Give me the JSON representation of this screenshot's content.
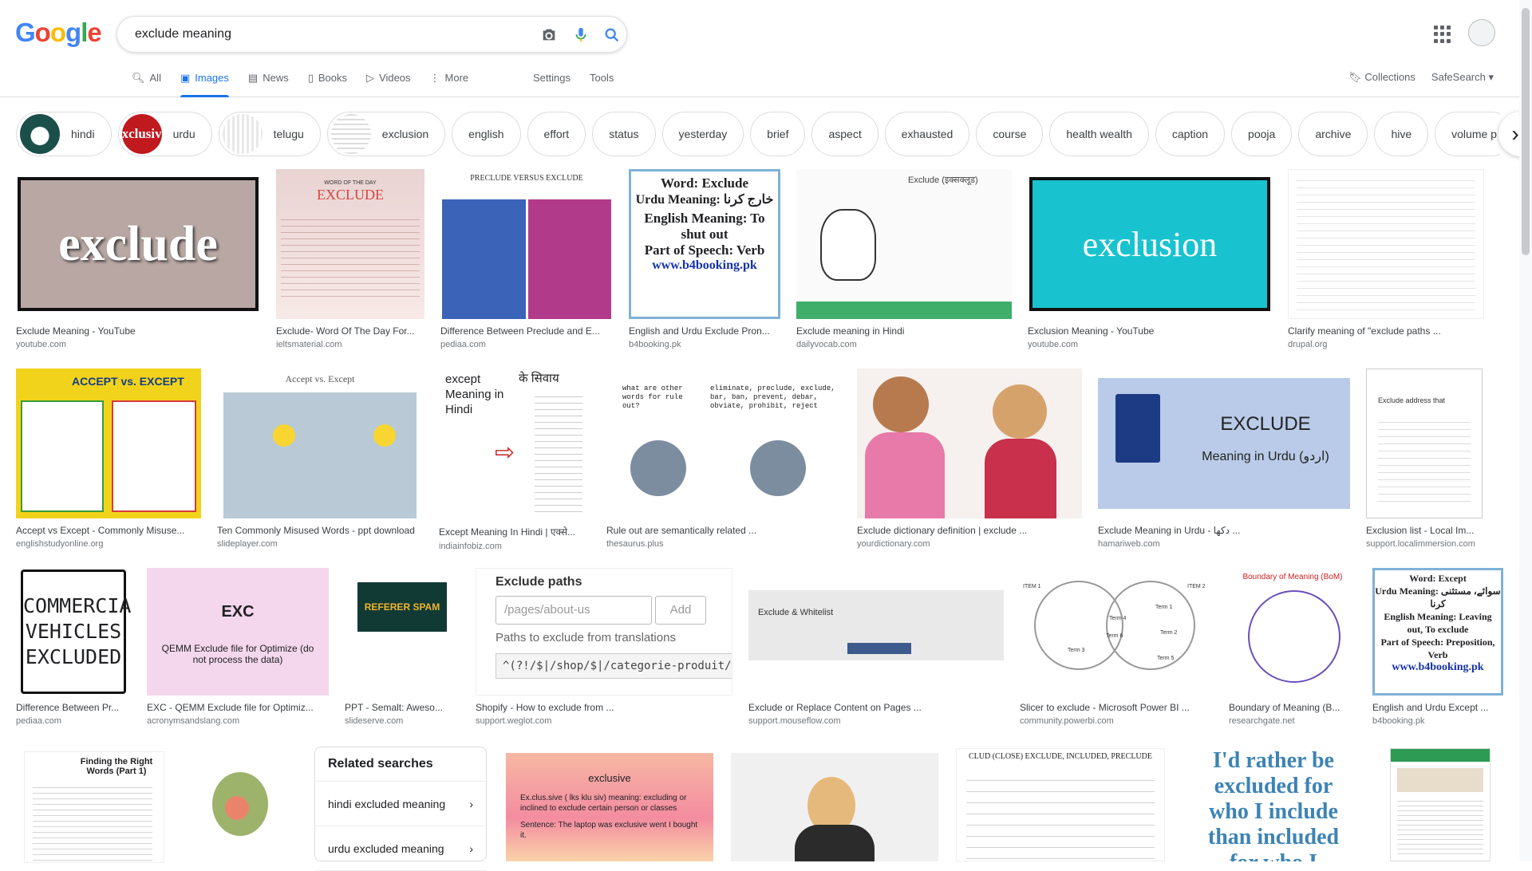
{
  "logo": "Google",
  "search": {
    "query": "exclude meaning"
  },
  "tabs": [
    {
      "label": "All",
      "icon": "search-icon"
    },
    {
      "label": "Images",
      "icon": "image-icon"
    },
    {
      "label": "News",
      "icon": "newspaper-icon"
    },
    {
      "label": "Books",
      "icon": "book-icon"
    },
    {
      "label": "Videos",
      "icon": "play-icon"
    },
    {
      "label": "More",
      "icon": "more-vert-icon"
    }
  ],
  "tools": {
    "settings": "Settings",
    "tools": "Tools"
  },
  "right_links": {
    "collections": "Collections",
    "safesearch": "SafeSearch"
  },
  "chips": [
    "hindi",
    "urdu",
    "telugu",
    "exclusion",
    "english",
    "effort",
    "status",
    "yesterday",
    "brief",
    "aspect",
    "exhausted",
    "course",
    "health wealth",
    "caption",
    "pooja",
    "archive",
    "hive",
    "volume p"
  ],
  "chip_thumb_texts": {
    "urdu": "xclusiv"
  },
  "row1": [
    {
      "title": "Exclude Meaning - YouTube",
      "source": "youtube.com",
      "img_text": "exclude"
    },
    {
      "title": "Exclude- Word Of The Day For...",
      "source": "ieltsmaterial.com",
      "img_text": "EXCLUDE",
      "img_subtitle": "WORD OF THE DAY"
    },
    {
      "title": "Difference Between Preclude and E...",
      "source": "pediaa.com",
      "img_text": "PRECLUDE VERSUS EXCLUDE"
    },
    {
      "title": "English and Urdu Exclude Pron...",
      "source": "b4booking.pk",
      "img_lines": [
        "Word: Exclude",
        "Urdu Meaning: خارج کرنا",
        "English Meaning: To shut out",
        "Part of Speech: Verb",
        "www.b4booking.pk"
      ]
    },
    {
      "title": "Exclude meaning in Hindi",
      "source": "dailyvocab.com",
      "img_text": "Exclude (इक्सक्लूड)"
    },
    {
      "title": "Exclusion Meaning - YouTube",
      "source": "youtube.com",
      "img_text": "exclusion"
    },
    {
      "title": "Clarify meaning of \"exclude paths ...",
      "source": "drupal.org"
    }
  ],
  "row2": [
    {
      "title": "Accept vs Except - Commonly Misuse...",
      "source": "englishstudyonline.org",
      "img_text": "ACCEPT vs. EXCEPT"
    },
    {
      "title": "Ten Commonly Misused Words - ppt download",
      "source": "slideplayer.com",
      "img_text": "Accept vs. Except"
    },
    {
      "title": "Except Meaning In Hindi | एक्से...",
      "source": "indiainfobiz.com",
      "img_text": "except Meaning in Hindi",
      "img_hindi": "के सिवाय"
    },
    {
      "title": "Rule out are semantically related ...",
      "source": "thesaurus.plus",
      "img_text": "what are other words for rule out?",
      "img_words": "eliminate, preclude, exclude, bar, ban, prevent, debar, obviate, prohibit, reject"
    },
    {
      "title": "Exclude dictionary definition | exclude ...",
      "source": "yourdictionary.com"
    },
    {
      "title": "Exclude Meaning in Urdu - دکھا ...",
      "source": "hamariweb.com",
      "img_text": "EXCLUDE",
      "img_sub": "Meaning in Urdu (اردو)"
    },
    {
      "title": "Exclusion list - Local Im...",
      "source": "support.localimmersion.com",
      "img_text": "Exclude address that"
    }
  ],
  "row3": [
    {
      "title": "Difference Between Pr...",
      "source": "pediaa.com",
      "img_lines": [
        "COMMERCIAL",
        "VEHICLES",
        "EXCLUDED"
      ]
    },
    {
      "title": "EXC - QEMM Exclude file for Optimiz...",
      "source": "acronymsandslang.com",
      "img_text": "EXC",
      "img_sub": "QEMM Exclude file for Optimize (do not process the data)"
    },
    {
      "title": "PPT - Semalt: Aweso...",
      "source": "slideserve.com",
      "img_text": "REFERER SPAM"
    },
    {
      "title": "Shopify - How to exclude from ...",
      "source": "support.weglot.com",
      "img_heading": "Exclude paths",
      "img_placeholder": "/pages/about-us",
      "img_add": "Add",
      "img_label": "Paths to exclude from translations",
      "img_code": "^(?!/$|/shop/$|/categorie-produit/$|/pr"
    },
    {
      "title": "Exclude or Replace Content on Pages ...",
      "source": "support.mouseflow.com",
      "img_text": "Exclude & Whitelist"
    },
    {
      "title": "Slicer to exclude - Microsoft Power BI ...",
      "source": "community.powerbi.com",
      "img_labels": [
        "ITEM 1",
        "ITEM 2",
        "Term 1",
        "Term 2",
        "Term 3",
        "Term 4",
        "Term 5",
        "Term 6"
      ]
    },
    {
      "title": "Boundary of Meaning (B...",
      "source": "researchgate.net",
      "img_text": "Boundary of Meaning (BoM)"
    },
    {
      "title": "English and Urdu Except ...",
      "source": "b4booking.pk",
      "img_lines": [
        "Word: Except",
        "Urdu Meaning: سوائے، مستثنی کرنا",
        "English Meaning: Leaving out, To exclude",
        "Part of Speech: Preposition, Verb",
        "www.b4booking.pk"
      ]
    }
  ],
  "related": {
    "heading": "Related searches",
    "items": [
      "hindi excluded meaning",
      "urdu excluded meaning"
    ]
  },
  "row4": [
    {
      "img_text": "Finding the Right Words (Part 1)"
    },
    {
      "img_text": ""
    },
    {
      "img_text": "exclusive",
      "img_bullets": [
        "Ex.clus.sive ( lks klu siv) meaning: excluding or inclined to exclude certain person or classes",
        "Sentence: The laptop was exclusive went I bought it."
      ]
    },
    {
      "img_text": ""
    },
    {
      "img_text": "CLUD (CLOSE) EXCLUDE, INCLUDED, PRECLUDE"
    },
    {
      "img_lines": [
        "I'd rather be",
        "excluded for",
        "who I include",
        "than included",
        "for who I"
      ]
    },
    {
      "img_text": ""
    }
  ],
  "colors": {
    "accent": "#1a73e8",
    "link_gray": "#5f6368"
  }
}
